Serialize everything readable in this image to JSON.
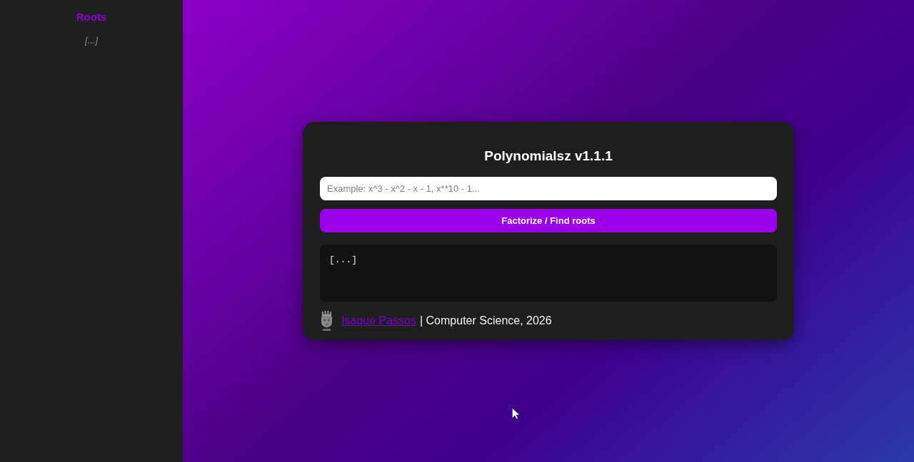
{
  "sidebar": {
    "title": "Roots",
    "content": "[...]"
  },
  "card": {
    "title": "Polynomialsz v1.1.1",
    "input": {
      "placeholder": "Example: x^3 - x^2 - x - 1, x**10 - 1..."
    },
    "button": "Factorize / Find roots",
    "output": "[...]",
    "footer": {
      "author": "Isaque Passos",
      "text": "| Computer Science, 2026"
    }
  }
}
